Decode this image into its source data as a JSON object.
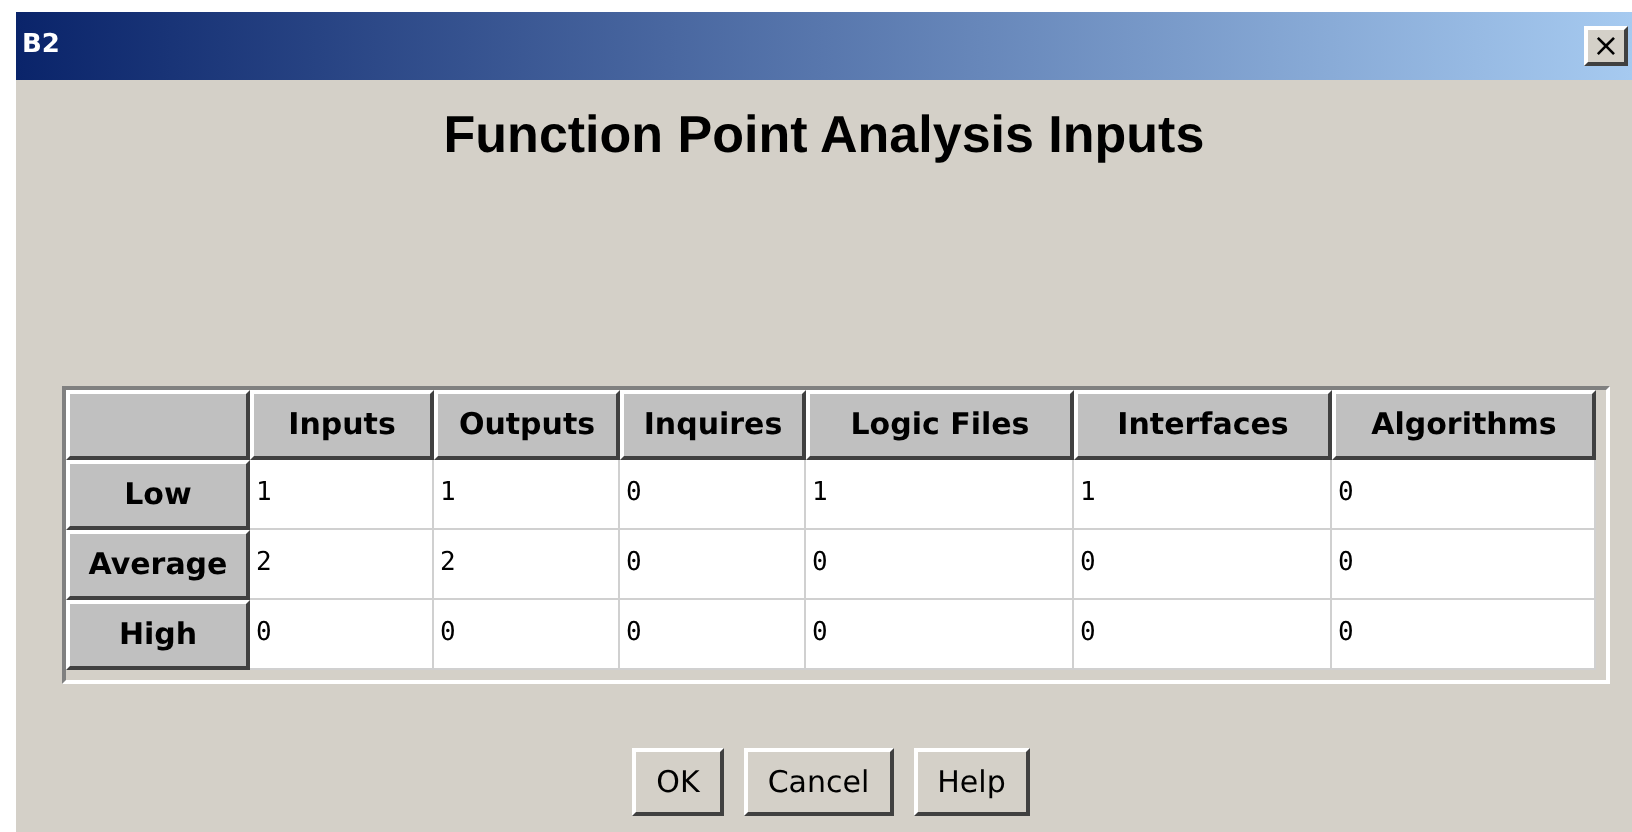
{
  "window": {
    "title": "B2",
    "close": "×"
  },
  "heading": "Function Point Analysis Inputs",
  "table": {
    "columns": [
      "Inputs",
      "Outputs",
      "Inquires",
      "Logic Files",
      "Interfaces",
      "Algorithms"
    ],
    "rows": [
      {
        "label": "Low",
        "cells": [
          "1",
          "1",
          "0",
          "1",
          "1",
          "0"
        ]
      },
      {
        "label": "Average",
        "cells": [
          "2",
          "2",
          "0",
          "0",
          "0",
          "0"
        ]
      },
      {
        "label": "High",
        "cells": [
          "0",
          "0",
          "0",
          "0",
          "0",
          "0"
        ]
      }
    ]
  },
  "buttons": [
    "OK",
    "Cancel",
    "Help"
  ]
}
